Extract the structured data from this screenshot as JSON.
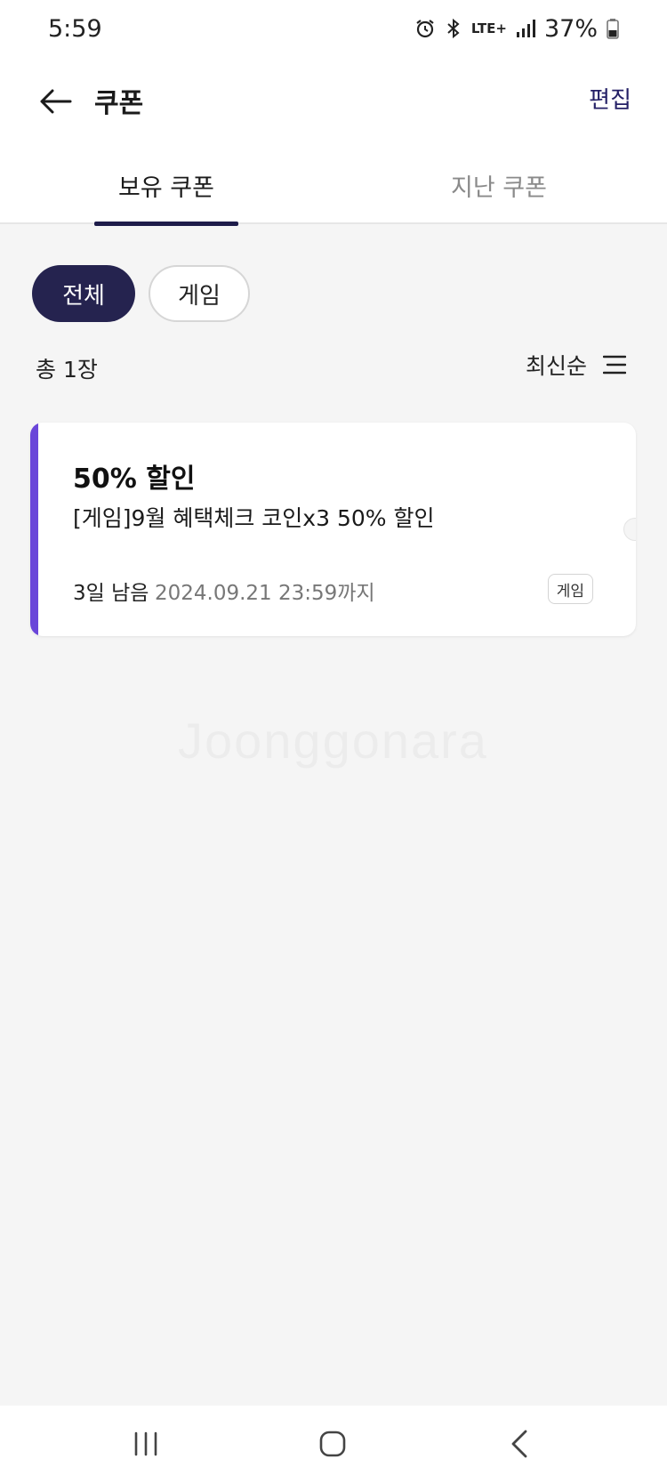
{
  "status_bar": {
    "time": "5:59",
    "network": "LTE+",
    "battery": "37%",
    "icons": [
      "alarm-icon",
      "bluetooth-icon",
      "lte-icon",
      "signal-icon",
      "battery-icon"
    ]
  },
  "header": {
    "title": "쿠폰",
    "edit_label": "편집",
    "back_icon": "arrow-left-icon"
  },
  "tabs": [
    {
      "label": "보유 쿠폰",
      "active": true
    },
    {
      "label": "지난 쿠폰",
      "active": false
    }
  ],
  "filters": [
    {
      "label": "전체",
      "selected": true
    },
    {
      "label": "게임",
      "selected": false
    }
  ],
  "summary": {
    "total": "총 1장",
    "sort_label": "최신순",
    "sort_icon": "sort-icon"
  },
  "coupons": [
    {
      "title": "50% 할인",
      "description": "[게임]9월 혜택체크 코인x3 50% 할인",
      "remaining": "3일 남음",
      "expiry": "2024.09.21 23:59까지",
      "tag": "게임",
      "accent_color": "#6a46d9"
    }
  ],
  "watermark": "Joonggonara",
  "nav_bar": {
    "icons": [
      "recent-apps-icon",
      "home-icon",
      "back-icon"
    ]
  },
  "colors": {
    "primary": "#25234f",
    "accent": "#6a46d9",
    "background": "#f5f5f5"
  }
}
